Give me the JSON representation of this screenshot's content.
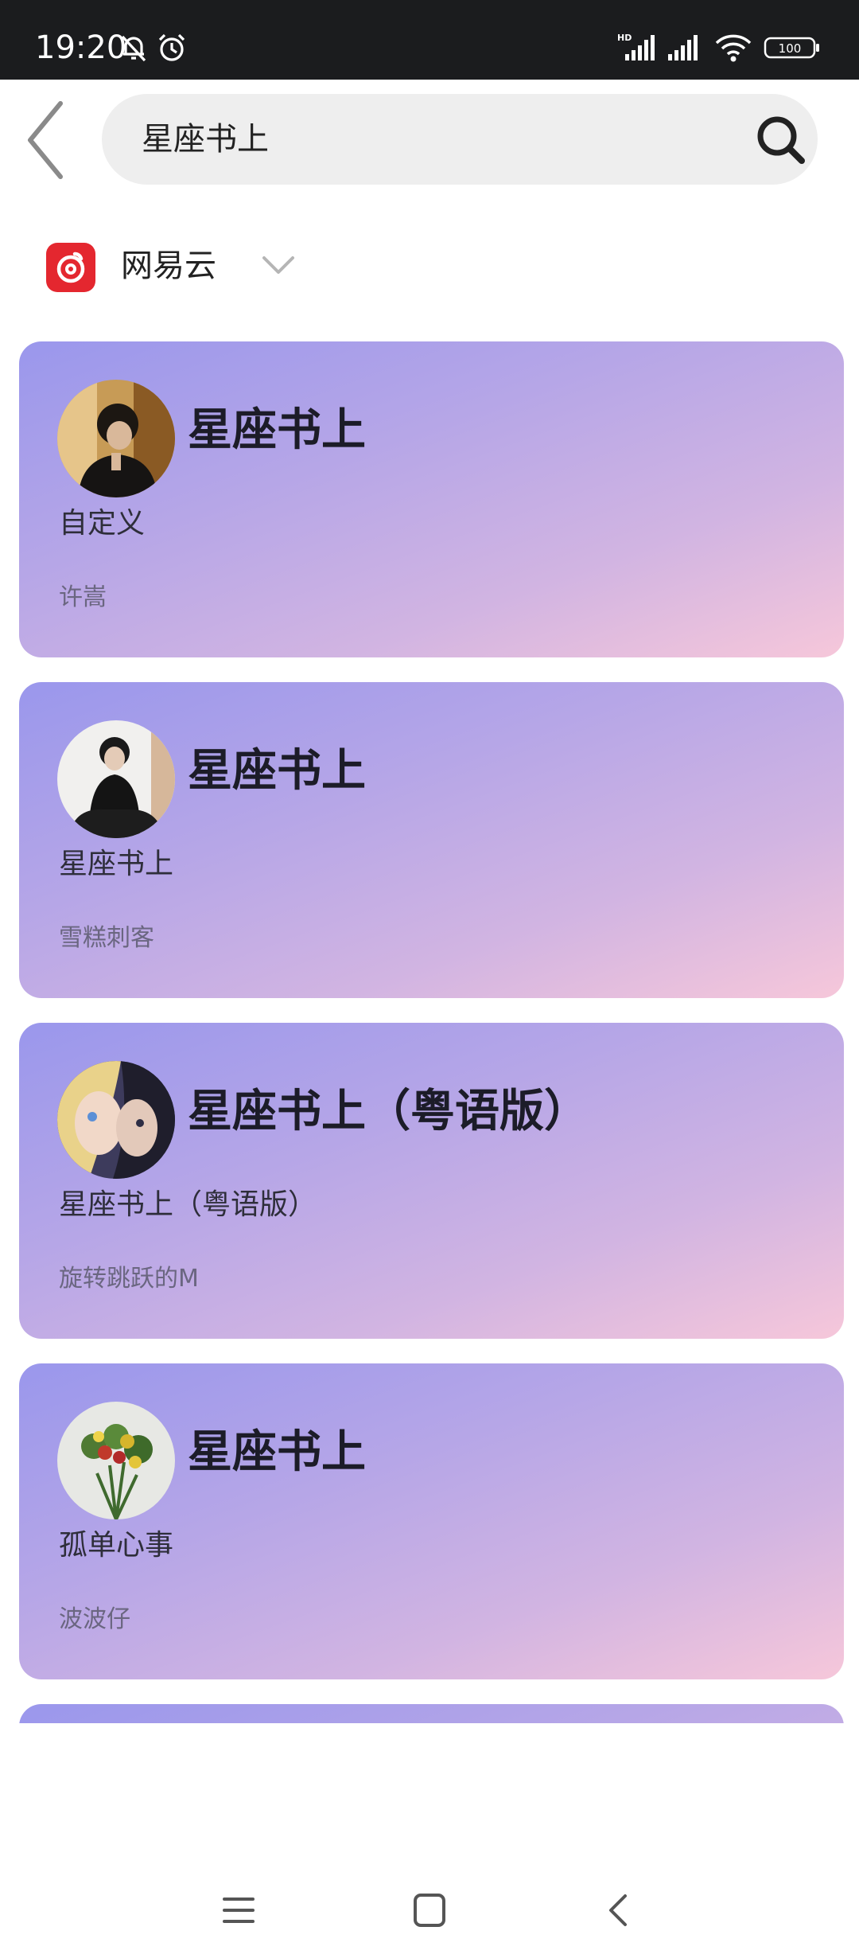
{
  "status_bar": {
    "time": "19:20",
    "icons": [
      "muted-bell-icon",
      "alarm-icon",
      "hd-signal-icon",
      "signal-icon",
      "wifi-icon",
      "battery-icon"
    ],
    "battery": "100"
  },
  "header": {
    "back_icon": "back-chevron-icon",
    "search_query": "星座书上",
    "search_icon": "search-icon"
  },
  "source_selector": {
    "logo_icon": "netease-cloud-music-icon",
    "label": "网易云",
    "dropdown_icon": "chevron-down-icon",
    "brand_color": "#e4272f"
  },
  "results": [
    {
      "title": "星座书上",
      "album": "自定义",
      "artist": "许嵩"
    },
    {
      "title": "星座书上",
      "album": "星座书上",
      "artist": "雪糕刺客"
    },
    {
      "title": "星座书上（粤语版）",
      "album": "星座书上（粤语版）",
      "artist": "旋转跳跃的M"
    },
    {
      "title": "星座书上",
      "album": "孤单心事",
      "artist": "波波仔"
    }
  ],
  "nav_bar": {
    "icons": [
      "menu-icon",
      "home-icon",
      "back-icon"
    ]
  },
  "colors": {
    "card_gradient_start": "#9a97ec",
    "card_gradient_end": "#f6c7da",
    "status_bar_bg": "#1b1c1e"
  }
}
